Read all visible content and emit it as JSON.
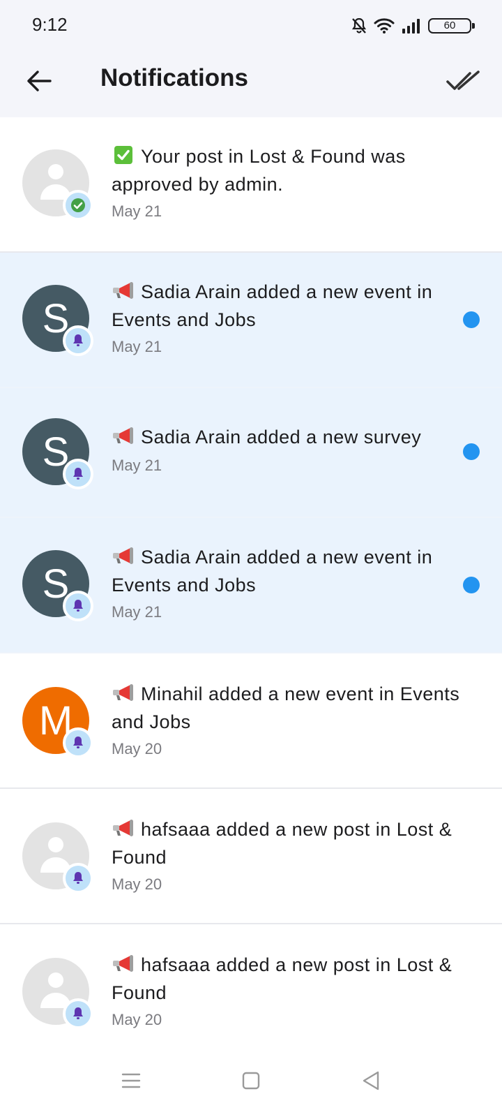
{
  "status": {
    "time": "9:12",
    "battery": "60"
  },
  "header": {
    "title": "Notifications"
  },
  "notifications": [
    {
      "emoji": "check",
      "text": "Your post in Lost & Found was approved by admin.",
      "date": "May 21",
      "unread": false,
      "avatar_letter": "",
      "badge": "check"
    },
    {
      "emoji": "megaphone",
      "text": "Sadia Arain added a new event in Events and Jobs",
      "date": "May 21",
      "unread": true,
      "avatar_letter": "S",
      "badge": "bell"
    },
    {
      "emoji": "megaphone",
      "text": "Sadia Arain added a new survey",
      "date": "May 21",
      "unread": true,
      "avatar_letter": "S",
      "badge": "bell"
    },
    {
      "emoji": "megaphone",
      "text": "Sadia Arain added a new event in Events and Jobs",
      "date": "May 21",
      "unread": true,
      "avatar_letter": "S",
      "badge": "bell"
    },
    {
      "emoji": "megaphone",
      "text": "Minahil added a new event in Events and Jobs",
      "date": "May 20",
      "unread": false,
      "avatar_letter": "M",
      "badge": "bell"
    },
    {
      "emoji": "megaphone",
      "text": "hafsaaa added a new post in Lost & Found",
      "date": "May 20",
      "unread": false,
      "avatar_letter": "",
      "badge": "bell"
    },
    {
      "emoji": "megaphone",
      "text": "hafsaaa added a new post in Lost & Found",
      "date": "May 20",
      "unread": false,
      "avatar_letter": "",
      "badge": "bell"
    }
  ],
  "colors": {
    "unread_bg": "#eaf3fd",
    "unread_dot": "#2394f0",
    "avatar_s": "#455a64",
    "avatar_m": "#ef6c00",
    "badge_bg": "#bfe1f9",
    "bell": "#5e35b1",
    "check": "#43a047"
  },
  "icons": {
    "back": "arrow-left-icon",
    "mark_all": "double-check-icon",
    "nav": [
      "menu-icon",
      "home-square-icon",
      "back-triangle-icon"
    ]
  }
}
